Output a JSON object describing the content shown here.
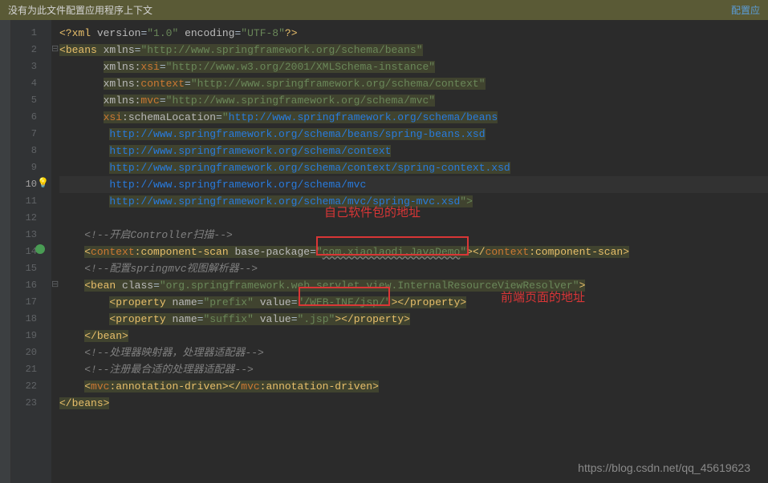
{
  "banner": {
    "left_text": "没有为此文件配置应用程序上下文",
    "right_link": "配置应"
  },
  "lines": {
    "l1": {
      "p1": "<?",
      "p2": "xml ",
      "p3": "version",
      "p4": "=",
      "p5": "\"1.0\" ",
      "p6": "encoding",
      "p7": "=",
      "p8": "\"UTF-8\"",
      "p9": "?>"
    },
    "l2": {
      "p1": "<",
      "p2": "beans ",
      "p3": "xmlns",
      "p4": "=",
      "p5": "\"http://www.springframework.org/schema/beans\""
    },
    "l3": {
      "p1": "xmlns:",
      "p2": "xsi",
      "p3": "=",
      "p4": "\"http://www.w3.org/2001/XMLSchema-instance\""
    },
    "l4": {
      "p1": "xmlns:",
      "p2": "context",
      "p3": "=",
      "p4": "\"http://www.springframework.org/schema/context\""
    },
    "l5": {
      "p1": "xmlns:",
      "p2": "mvc",
      "p3": "=",
      "p4": "\"http://www.springframework.org/schema/mvc\""
    },
    "l6": {
      "p1": "xsi",
      "p2": ":schemaLocation",
      "p3": "=",
      "p4": "\"",
      "p5": "http://www.springframework.org/schema/beans"
    },
    "l7": {
      "p1": "http://www.springframework.org/schema/beans/spring-beans.xsd"
    },
    "l8": {
      "p1": "http://www.springframework.org/schema/context"
    },
    "l9": {
      "p1": "http://www.springframework.org/schema/context/spring-context.xsd"
    },
    "l10": {
      "p1": "http://www.springframework.org/schema/mvc"
    },
    "l11": {
      "p1": "http://www.springframework.org/schema/mvc/spring-mvc.xsd",
      "p2": "\">"
    },
    "l13": {
      "p1": "<!--开启Controller扫描-->"
    },
    "l14": {
      "p1": "<",
      "p2": "context",
      "p3": ":component-scan ",
      "p4": "base-package",
      "p5": "=",
      "p6": "\"",
      "p7": "com.xiaolaodi.JavaDemo",
      "p8": "\"",
      "p9": "></",
      "p10": "context",
      "p11": ":component-scan>"
    },
    "l15": {
      "p1": "<!--配置springmvc视图解析器-->"
    },
    "l16": {
      "p1": "<",
      "p2": "bean ",
      "p3": "class",
      "p4": "=",
      "p5": "\"org.springframework.web.servlet.view.InternalResourceViewResolver\"",
      "p6": ">"
    },
    "l17": {
      "p1": "<",
      "p2": "property ",
      "p3": "name",
      "p4": "=",
      "p5": "\"prefix\" ",
      "p6": "value",
      "p7": "=",
      "p8": "\"",
      "p9": "/WEB-INF/jsp/",
      "p10": "\"",
      "p11": "></",
      "p12": "property>"
    },
    "l18": {
      "p1": "<",
      "p2": "property ",
      "p3": "name",
      "p4": "=",
      "p5": "\"suffix\" ",
      "p6": "value",
      "p7": "=",
      "p8": "\".jsp\"",
      "p9": "></",
      "p10": "property>"
    },
    "l19": {
      "p1": "</",
      "p2": "bean>"
    },
    "l20": {
      "p1": "<!--处理器映射器，处理器适配器-->"
    },
    "l21": {
      "p1": "<!--注册最合适的处理器适配器-->"
    },
    "l22": {
      "p1": "<",
      "p2": "mvc",
      "p3": ":annotation-driven></",
      "p4": "mvc",
      "p5": ":annotation-driven>"
    },
    "l23": {
      "p1": "</",
      "p2": "beans>"
    }
  },
  "annotations": {
    "label1": "自己软件包的地址",
    "label2": "前端页面的地址"
  },
  "watermark": "https://blog.csdn.net/qq_45619623",
  "line_numbers": [
    "1",
    "2",
    "3",
    "4",
    "5",
    "6",
    "7",
    "8",
    "9",
    "10",
    "11",
    "12",
    "13",
    "14",
    "15",
    "16",
    "17",
    "18",
    "19",
    "20",
    "21",
    "22",
    "23"
  ]
}
